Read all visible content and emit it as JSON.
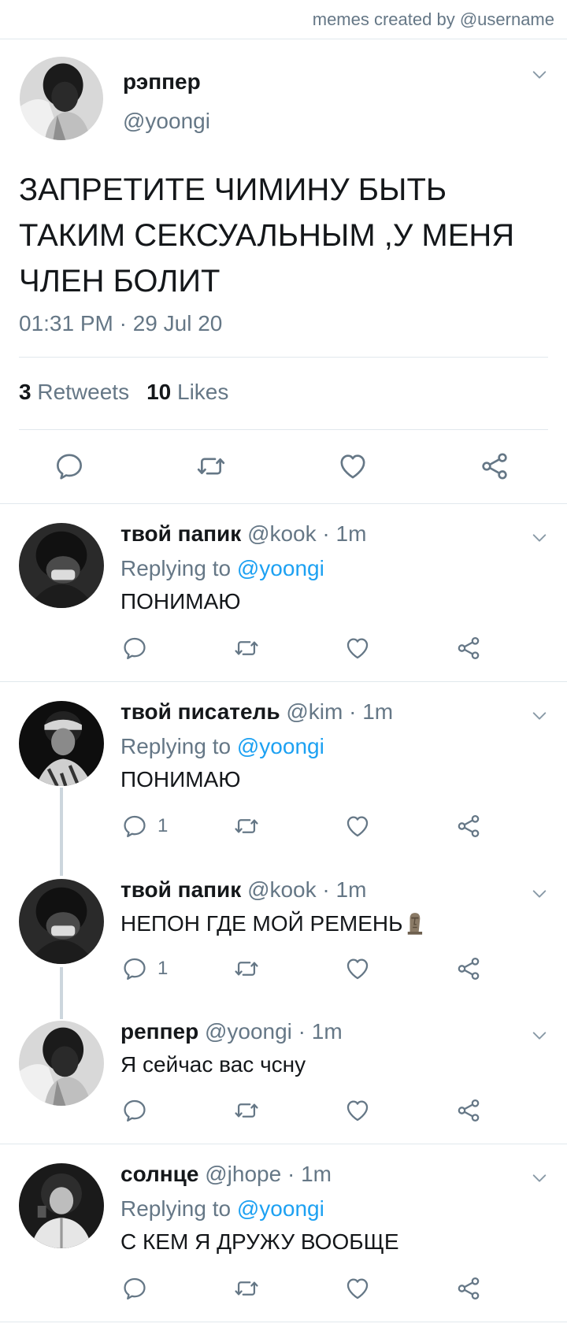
{
  "header": {
    "watermark": "memes created by @username"
  },
  "main_tweet": {
    "name": "рэппер",
    "handle": "@yoongi",
    "text": "ЗАПРЕТИТЕ ЧИМИНУ БЫТЬ ТАКИМ СЕКСУАЛЬНЫМ ,У МЕНЯ ЧЛЕН БОЛИТ",
    "timestamp": "01:31 PM · 29 Jul 20",
    "retweets_count": "3",
    "retweets_label": "Retweets",
    "likes_count": "10",
    "likes_label": "Likes"
  },
  "replies": [
    {
      "name": "твой папик",
      "meta": "@kook · 1m",
      "replying_prefix": "Replying to",
      "replying_to": "@yoongi",
      "text": "ПОНИМАЮ",
      "reply_count": ""
    },
    {
      "name": "твой писатель",
      "meta": "@kim · 1m",
      "replying_prefix": "Replying to",
      "replying_to": "@yoongi",
      "text": "ПОНИМАЮ",
      "reply_count": "1"
    },
    {
      "name": "твой папик",
      "meta": "@kook · 1m",
      "text": "НЕПОН ГДЕ МОЙ РЕМЕНЬ",
      "emoji": "moai",
      "reply_count": "1"
    },
    {
      "name": "реппер",
      "meta": "@yoongi · 1m",
      "text": "Я сейчас вас чсну",
      "reply_count": ""
    },
    {
      "name": "солнце",
      "meta": "@jhope · 1m",
      "replying_prefix": "Replying to",
      "replying_to": "@yoongi",
      "text": "С КЕМ Я ДРУЖУ ВООБЩЕ",
      "reply_count": ""
    }
  ],
  "icons": {
    "reply": "reply-icon",
    "retweet": "retweet-icon",
    "like": "heart-icon",
    "share": "share-icon",
    "menu": "chevron-down-icon"
  },
  "colors": {
    "text": "#14171a",
    "secondary": "#657786",
    "link": "#1da1f2",
    "divider": "#e1e8ed",
    "thread_line": "#ccd6dd"
  }
}
